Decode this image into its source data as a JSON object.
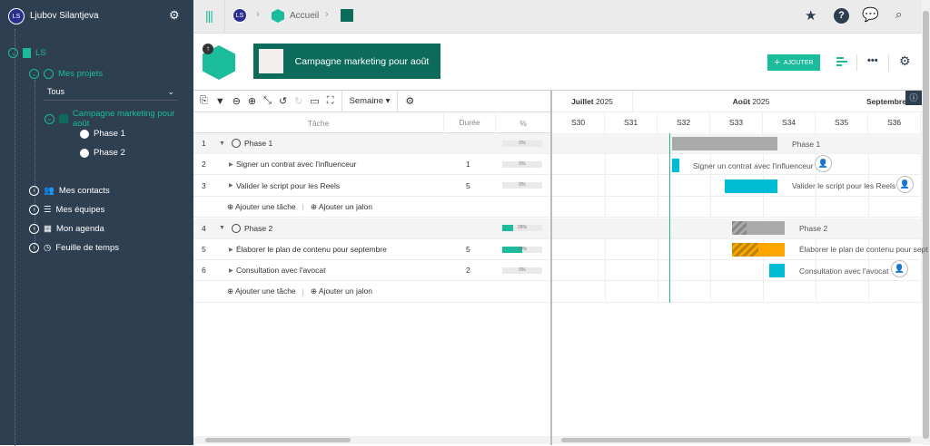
{
  "user": {
    "initials": "LS",
    "name": "Ljubov Silantjeva"
  },
  "sidebar": {
    "root": "LS",
    "projects": "Mes projets",
    "filter": "Tous",
    "project": "Campagne marketing pour août",
    "phases": [
      "Phase 1",
      "Phase 2"
    ],
    "items": [
      {
        "label": "Mes contacts",
        "icon": "contacts-icon"
      },
      {
        "label": "Mes équipes",
        "icon": "teams-icon"
      },
      {
        "label": "Mon agenda",
        "icon": "calendar-icon"
      },
      {
        "label": "Feuille de temps",
        "icon": "clock-icon"
      }
    ]
  },
  "breadcrumb": {
    "initials": "LS",
    "home": "Accueil"
  },
  "project": {
    "title": "Campagne marketing pour août",
    "add_button": "AJOUTER"
  },
  "toolbar": {
    "scale": "Semaine"
  },
  "columns": {
    "task": "Tâche",
    "duration": "Durée",
    "percent": "%"
  },
  "rows": [
    {
      "num": "1",
      "name": "Phase 1",
      "type": "phase",
      "duration": "",
      "percent": "0%",
      "progress": 0
    },
    {
      "num": "2",
      "name": "Signer un contrat avec l'influenceur",
      "type": "task",
      "duration": "1",
      "percent": "0%",
      "progress": 0
    },
    {
      "num": "3",
      "name": "Valider le script pour les Reels",
      "type": "task",
      "duration": "5",
      "percent": "0%",
      "progress": 0
    },
    {
      "num": "4",
      "name": "Phase 2",
      "type": "phase",
      "duration": "",
      "percent": "28%",
      "progress": 28
    },
    {
      "num": "5",
      "name": "Élaborer le plan de contenu pour septembre",
      "type": "task",
      "duration": "5",
      "percent": "50%",
      "progress": 50
    },
    {
      "num": "6",
      "name": "Consultation avec l'avocat",
      "type": "task",
      "duration": "2",
      "percent": "0%",
      "progress": 0
    }
  ],
  "add": {
    "task": "Ajouter une tâche",
    "milestone": "Ajouter un jalon"
  },
  "gantt": {
    "months": [
      {
        "bold": "Juillet",
        "year": "2025"
      },
      {
        "bold": "Août",
        "year": "2025"
      },
      {
        "bold": "Septembre",
        "year": ""
      }
    ],
    "weeks": [
      "S30",
      "S31",
      "S32",
      "S33",
      "S34",
      "S35",
      "S36"
    ],
    "bar_labels": [
      "Phase 1",
      "Signer un contrat avec l'influenceur",
      "Valider le script pour les Reels",
      "Phase 2",
      "Élaborer le plan de contenu pour sept",
      "Consultation avec l'avocat"
    ]
  },
  "colors": {
    "sidebar": "#2e3f51",
    "accent": "#1abc9c",
    "project": "#0c6b5a",
    "task_bar": "#00bcd4",
    "phase_bar": "#aaaaaa",
    "late_bar": "#ffa500"
  }
}
